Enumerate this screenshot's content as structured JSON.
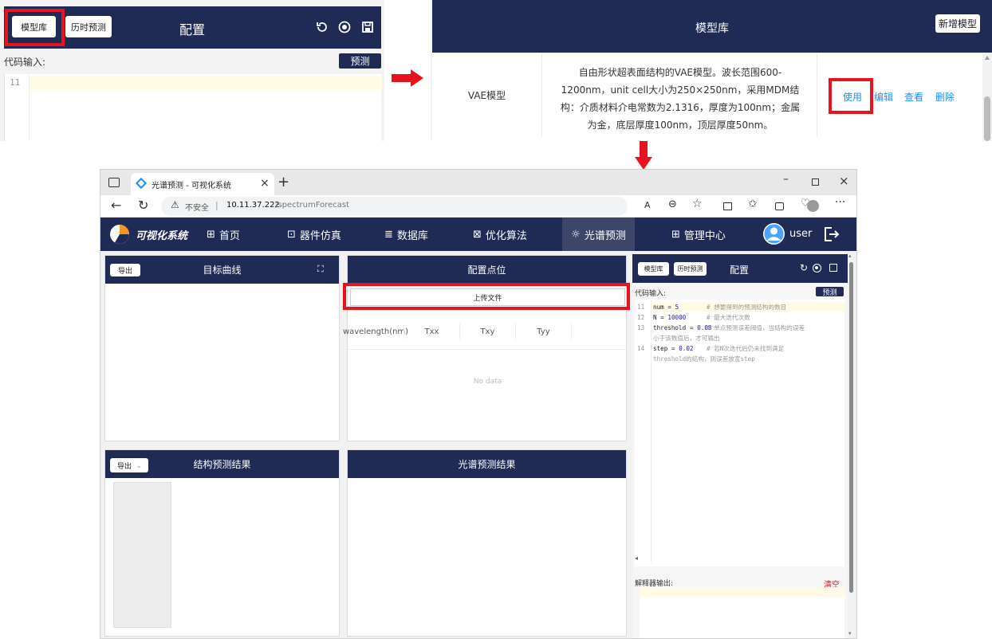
{
  "top_left": {
    "model_lib": "模型库",
    "history": "历时预测",
    "title": "配置",
    "code_label": "代码输入:",
    "predict": "预测",
    "line_no": "11"
  },
  "top_right": {
    "title": "模型库",
    "add_model": "新增模型",
    "row": {
      "name": "VAE模型",
      "desc": "自由形状超表面结构的VAE模型。波长范围600-1200nm，unit cell大小为250×250nm，采用MDM结构：介质材料介电常数为2.1316，厚度为100nm；金属为金，底层厚度100nm，顶层厚度50nm。",
      "use": "使用",
      "edit": "编辑",
      "view": "查看",
      "delete": "删除"
    }
  },
  "browser": {
    "tab_title": "光谱预测 - 可视化系统",
    "insecure": "不安全",
    "address_host": "10.11.37.222",
    "address_path": "/spectrumForecast"
  },
  "app": {
    "brand": "可视化系统",
    "menu": [
      "首页",
      "器件仿真",
      "数据库",
      "优化算法",
      "光谱预测",
      "管理中心"
    ],
    "user": "user"
  },
  "target": {
    "export": "导出",
    "title": "目标曲线"
  },
  "config_points": {
    "title": "配置点位",
    "upload": "上传文件",
    "columns": [
      "wavelength(nm)",
      "Txx",
      "Txy",
      "Tyy"
    ],
    "empty": "No data"
  },
  "structure": {
    "export": "导出",
    "title": "结构预测结果"
  },
  "spectrum": {
    "title": "光谱预测结果"
  },
  "config": {
    "model_lib": "模型库",
    "history": "历时预测",
    "title": "配置",
    "code_label": "代码输入:",
    "predict": "预测",
    "output_label": "解释器输出:",
    "clear": "清空",
    "code": [
      {
        "n": "11",
        "var": "num",
        "op": " = ",
        "val": "5",
        "comment": "# 想要得到的预测结构的数目"
      },
      {
        "n": "12",
        "var": "N",
        "op": " = ",
        "val": "10000",
        "comment": "# 最大迭代次数"
      },
      {
        "n": "13",
        "var": "threshold",
        "op": " = ",
        "val": "0.08",
        "comment": "# 单点预测误差阈值，当结构的误差",
        "cont": "小于该数值后，才可输出"
      },
      {
        "n": "14",
        "var": "step",
        "op": " = ",
        "val": "0.02",
        "comment": "# 若N次迭代后仍未找到满足",
        "cont": "threshold的结构，则误差放宽step"
      }
    ]
  },
  "colors": {
    "navy": "#1f2a55",
    "annotation_red": "#e8141d",
    "link_blue": "#1890ff"
  }
}
